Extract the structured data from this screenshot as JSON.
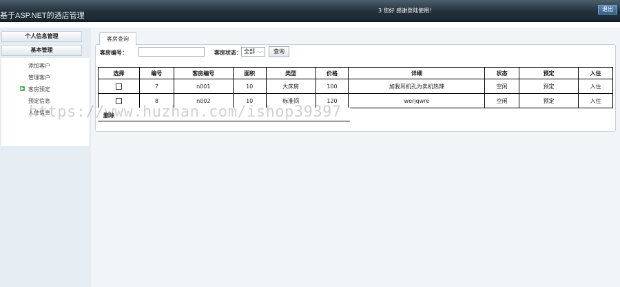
{
  "header": {
    "app_title": "基于ASP.NET的酒店管理",
    "greeting": "3 您好 感谢登陆使用！",
    "logout_label": "退出"
  },
  "sidebar": {
    "sections": [
      {
        "label": "个人信息管理"
      },
      {
        "label": "基本管理"
      }
    ],
    "items": [
      {
        "label": "添加客户"
      },
      {
        "label": "管理客户"
      },
      {
        "label": "客房预定",
        "active": true
      },
      {
        "label": "预定信息"
      },
      {
        "label": "入住信息"
      }
    ]
  },
  "main": {
    "tab_label": "客房查询",
    "search": {
      "room_no_label": "客房编号：",
      "room_no_value": "",
      "status_label": "客房状态：",
      "status_value": "全部",
      "query_label": "查询"
    },
    "table": {
      "headers": [
        "选择",
        "编号",
        "客房编号",
        "面积",
        "类型",
        "价格",
        "详细",
        "状态",
        "预定",
        "入住"
      ],
      "rows": [
        [
          "",
          "7",
          "n001",
          "10",
          "大床房",
          "100",
          "加我耳机孔为卖机热辣",
          "空闲",
          "预定",
          "入住"
        ],
        [
          "",
          "8",
          "n002",
          "10",
          "标准间",
          "120",
          "werjqwre",
          "空闲",
          "预定",
          "入住"
        ]
      ],
      "footer_text": "删除"
    }
  },
  "watermark": "https://www.huzhan.com/ishop39397",
  "colors": {
    "topbar": "#24313b",
    "sidebar_bg": "#e5edf2",
    "main_bg": "#f1f5f8",
    "logout_bg": "#2f5f8f"
  }
}
